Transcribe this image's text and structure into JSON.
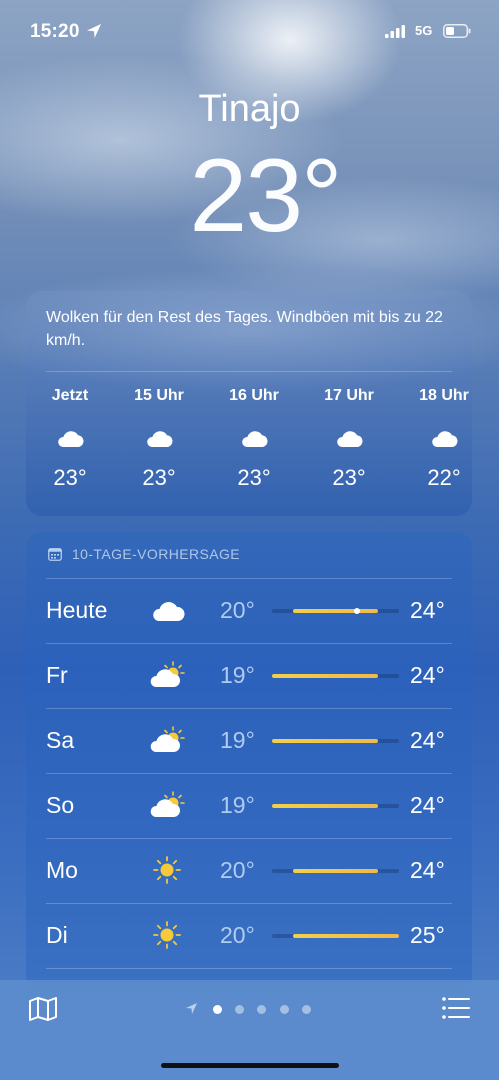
{
  "status_bar": {
    "time": "15:20",
    "network": "5G"
  },
  "location": {
    "city": "Tinajo",
    "current_temp": "23°"
  },
  "hourly": {
    "summary": "Wolken für den Rest des Tages. Windböen mit bis zu 22 km/h.",
    "hours": [
      {
        "label": "Jetzt",
        "icon": "cloud-icon",
        "temp": "23°"
      },
      {
        "label": "15 Uhr",
        "icon": "cloud-icon",
        "temp": "23°"
      },
      {
        "label": "16 Uhr",
        "icon": "cloud-icon",
        "temp": "23°"
      },
      {
        "label": "17 Uhr",
        "icon": "cloud-icon",
        "temp": "23°"
      },
      {
        "label": "18 Uhr",
        "icon": "cloud-icon",
        "temp": "22°"
      }
    ]
  },
  "forecast": {
    "header": "10-TAGE-VORHERSAGE",
    "range_min": 19,
    "range_max": 25,
    "days": [
      {
        "day": "Heute",
        "icon": "cloud-icon",
        "low": "20°",
        "high": "24°",
        "low_val": 20,
        "high_val": 24,
        "current_val": 23
      },
      {
        "day": "Fr",
        "icon": "partly-sunny-icon",
        "low": "19°",
        "high": "24°",
        "low_val": 19,
        "high_val": 24
      },
      {
        "day": "Sa",
        "icon": "partly-sunny-icon",
        "low": "19°",
        "high": "24°",
        "low_val": 19,
        "high_val": 24
      },
      {
        "day": "So",
        "icon": "partly-sunny-icon",
        "low": "19°",
        "high": "24°",
        "low_val": 19,
        "high_val": 24
      },
      {
        "day": "Mo",
        "icon": "sun-icon",
        "low": "20°",
        "high": "24°",
        "low_val": 20,
        "high_val": 24
      },
      {
        "day": "Di",
        "icon": "sun-icon",
        "low": "20°",
        "high": "25°",
        "low_val": 20,
        "high_val": 25
      }
    ]
  },
  "bottom_bar": {
    "left_icon": "map-icon",
    "right_icon": "list-icon",
    "pages": 5,
    "active_page": 1
  }
}
